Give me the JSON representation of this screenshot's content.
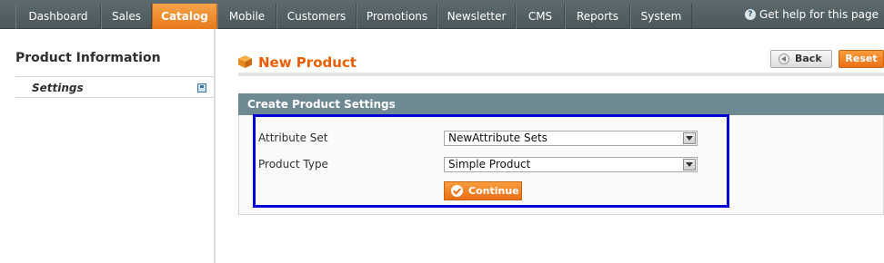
{
  "nav": {
    "items": [
      "Dashboard",
      "Sales",
      "Catalog",
      "Mobile",
      "Customers",
      "Promotions",
      "Newsletter",
      "CMS",
      "Reports",
      "System"
    ],
    "active": "Catalog",
    "help_label": "Get help for this page"
  },
  "sidebar": {
    "title": "Product Information",
    "items": [
      {
        "label": "Settings"
      }
    ]
  },
  "header": {
    "title": "New Product",
    "back_label": "Back",
    "reset_label": "Reset"
  },
  "section": {
    "title": "Create Product Settings",
    "attribute_set_label": "Attribute Set",
    "attribute_set_value": "NewAttribute Sets",
    "product_type_label": "Product Type",
    "product_type_value": "Simple Product",
    "continue_label": "Continue"
  },
  "colors": {
    "accent": "#eb6f13",
    "nav_bg": "#566266",
    "highlight": "#0000d4"
  }
}
